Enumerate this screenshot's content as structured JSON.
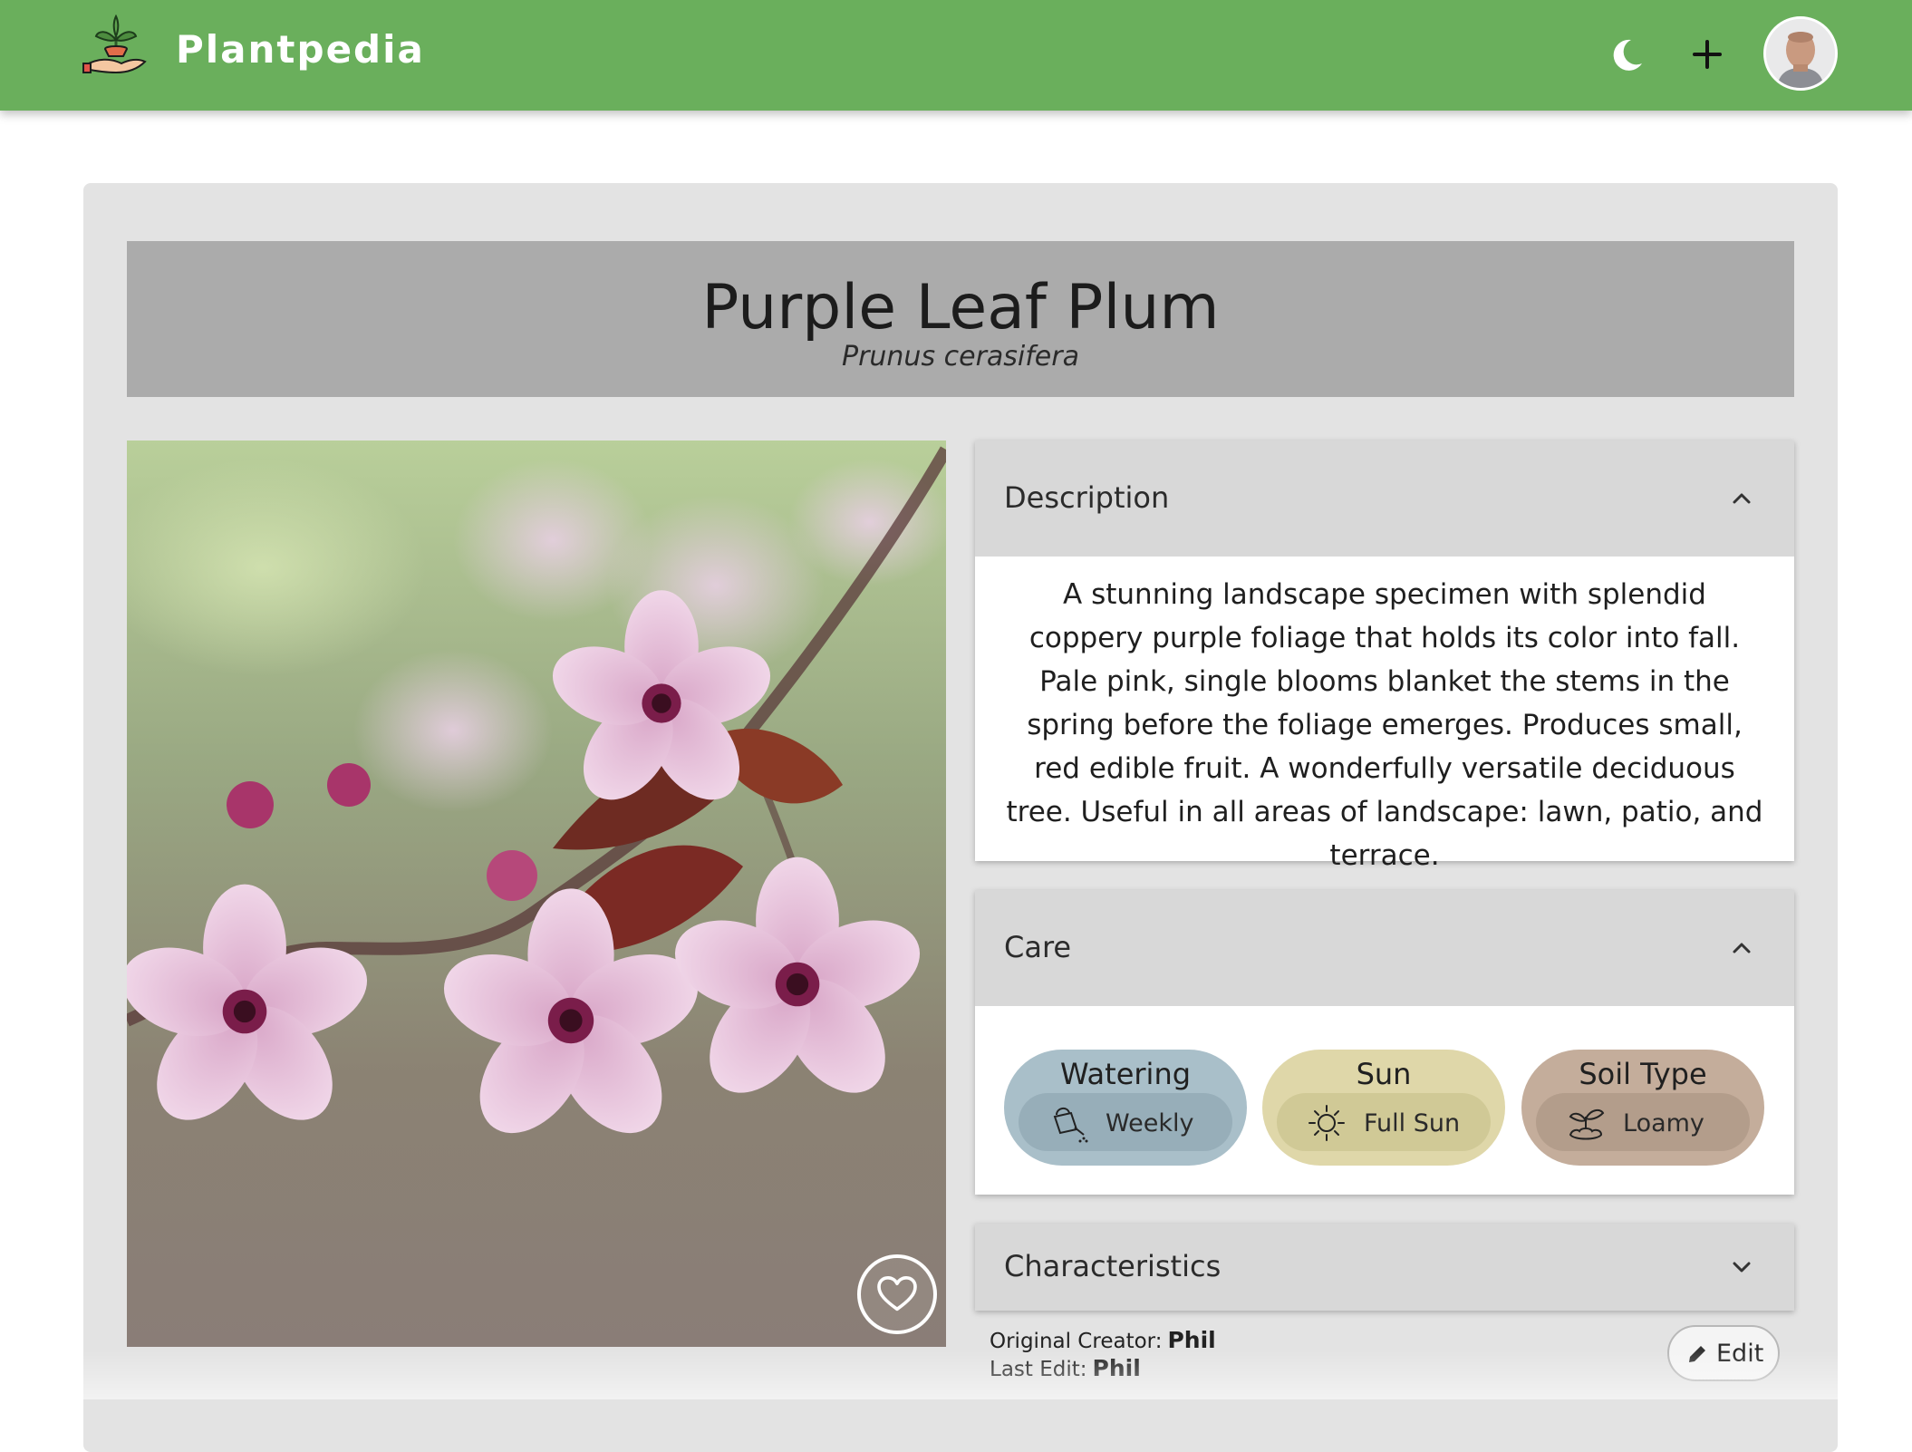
{
  "app": {
    "brand": "Plantpedia"
  },
  "header": {
    "icons": {
      "logo": "plant-in-hand-icon",
      "theme": "moon-icon",
      "add": "plus-icon",
      "profile": "avatar"
    },
    "brand_color": "#6aaf5c"
  },
  "plant": {
    "name": "Purple Leaf Plum",
    "scientific_name": "Prunus cerasifera"
  },
  "description": {
    "title": "Description",
    "text": "A stunning landscape specimen with splendid coppery purple foliage that holds its color into fall. Pale pink, single blooms blanket the stems in the spring before the foliage emerges. Produces small, red edible fruit. A wonderfully versatile deciduous tree. Useful in all areas of landscape: lawn, patio, and terrace.",
    "expanded": true
  },
  "care": {
    "title": "Care",
    "expanded": true,
    "items": [
      {
        "label": "Watering",
        "value": "Weekly",
        "icon": "watering-can-icon",
        "color": "#a9bfc9"
      },
      {
        "label": "Sun",
        "value": "Full Sun",
        "icon": "sun-icon",
        "color": "#dfd7a9"
      },
      {
        "label": "Soil Type",
        "value": "Loamy",
        "icon": "sprout-soil-icon",
        "color": "#c4ad9b"
      }
    ]
  },
  "characteristics": {
    "title": "Characteristics",
    "expanded": false
  },
  "meta": {
    "creator_label": "Original Creator:",
    "creator": "Phil",
    "last_edit_label": "Last Edit:",
    "last_editor": "Phil"
  },
  "actions": {
    "edit_label": "Edit",
    "favorite_icon": "heart-icon"
  }
}
